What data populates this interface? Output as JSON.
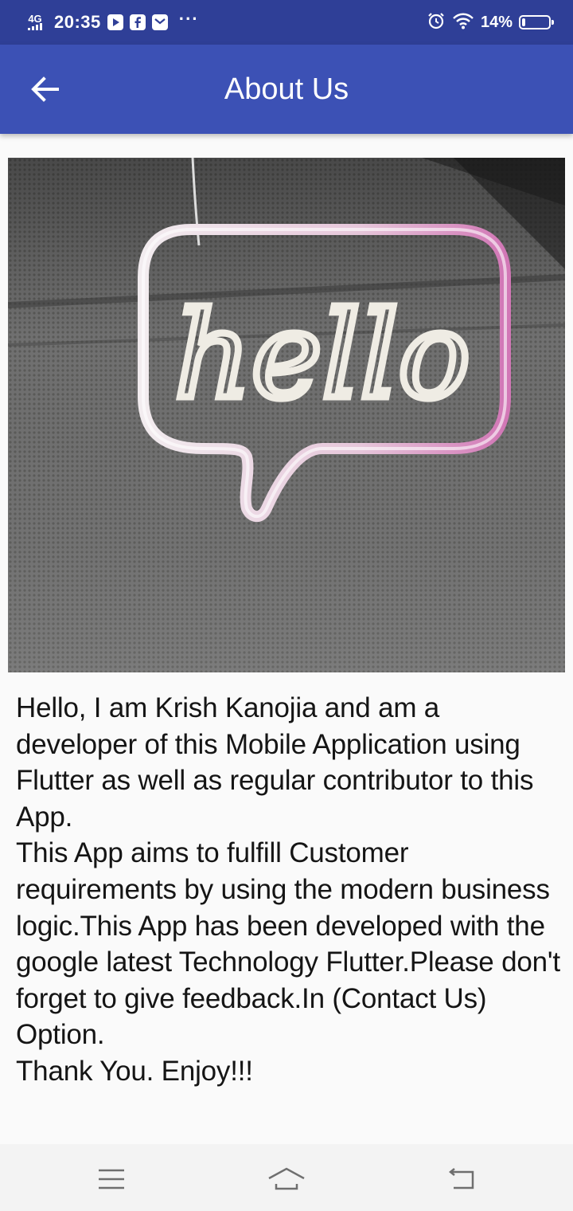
{
  "status_bar": {
    "network": "4G",
    "time": "20:35",
    "more": "···",
    "battery_percent": "14%",
    "battery_level": 0.14
  },
  "app_bar": {
    "title": "About Us",
    "back_icon": "arrow-back-icon"
  },
  "hero_image": {
    "neon_text": "hello"
  },
  "about": {
    "paragraphs": [
      "Hello, I am Krish Kanojia and am a developer of this Mobile Application using Flutter as well as regular contributor to this App.",
      "This App aims to fulfill Customer requirements by using the modern business logic.This App has been developed with the google latest Technology Flutter.Please don't forget to give feedback.In (Contact Us) Option.",
      "Thank You. Enjoy!!!"
    ]
  },
  "nav_bar": {
    "icons": [
      "menu-icon",
      "home-icon",
      "back-icon"
    ]
  },
  "colors": {
    "status_bar": "#2f3f97",
    "app_bar": "#3c51b5",
    "background": "#fafafa"
  }
}
